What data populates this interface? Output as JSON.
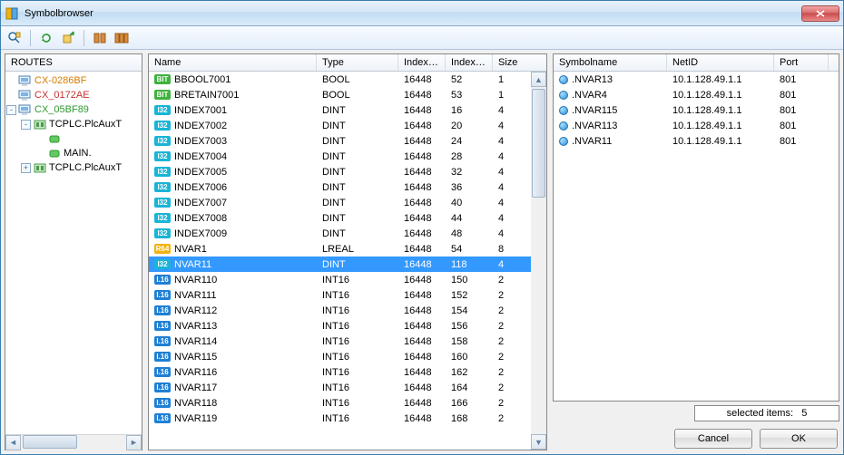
{
  "window": {
    "title": "Symbolbrowser"
  },
  "toolbar": {
    "items": [
      "find",
      "refresh",
      "export",
      "sep",
      "connect",
      "connect-multi"
    ]
  },
  "tree": {
    "header": "ROUTES",
    "nodes": [
      {
        "indent": 0,
        "icon": "pc",
        "label": "CX-0286BF",
        "class": "c-orange",
        "toggle": null
      },
      {
        "indent": 0,
        "icon": "pc",
        "label": "CX_0172AE",
        "class": "c-red",
        "toggle": null
      },
      {
        "indent": 0,
        "icon": "pc",
        "label": "CX_05BF89",
        "class": "c-green",
        "toggle": "-"
      },
      {
        "indent": 1,
        "icon": "db",
        "label": "TCPLC.PlcAuxT",
        "class": "",
        "toggle": "-"
      },
      {
        "indent": 2,
        "icon": "var",
        "label": "",
        "class": "",
        "toggle": null
      },
      {
        "indent": 2,
        "icon": "var",
        "label": "MAIN.",
        "class": "",
        "toggle": null
      },
      {
        "indent": 1,
        "icon": "db",
        "label": "TCPLC.PlcAuxT",
        "class": "",
        "toggle": "+"
      }
    ]
  },
  "grid": {
    "cols": [
      "Name",
      "Type",
      "Index-...",
      "Index-...",
      "Size"
    ],
    "rows": [
      {
        "chip": "bit",
        "chipTxt": "BIT",
        "name": "BBOOL7001",
        "type": "BOOL",
        "i1": "16448",
        "i2": "52",
        "sz": "1",
        "sel": false
      },
      {
        "chip": "bit",
        "chipTxt": "BIT",
        "name": "BRETAIN7001",
        "type": "BOOL",
        "i1": "16448",
        "i2": "53",
        "sz": "1",
        "sel": false
      },
      {
        "chip": "i32",
        "chipTxt": "I32",
        "name": "INDEX7001",
        "type": "DINT",
        "i1": "16448",
        "i2": "16",
        "sz": "4",
        "sel": false
      },
      {
        "chip": "i32",
        "chipTxt": "I32",
        "name": "INDEX7002",
        "type": "DINT",
        "i1": "16448",
        "i2": "20",
        "sz": "4",
        "sel": false
      },
      {
        "chip": "i32",
        "chipTxt": "I32",
        "name": "INDEX7003",
        "type": "DINT",
        "i1": "16448",
        "i2": "24",
        "sz": "4",
        "sel": false
      },
      {
        "chip": "i32",
        "chipTxt": "I32",
        "name": "INDEX7004",
        "type": "DINT",
        "i1": "16448",
        "i2": "28",
        "sz": "4",
        "sel": false
      },
      {
        "chip": "i32",
        "chipTxt": "I32",
        "name": "INDEX7005",
        "type": "DINT",
        "i1": "16448",
        "i2": "32",
        "sz": "4",
        "sel": false
      },
      {
        "chip": "i32",
        "chipTxt": "I32",
        "name": "INDEX7006",
        "type": "DINT",
        "i1": "16448",
        "i2": "36",
        "sz": "4",
        "sel": false
      },
      {
        "chip": "i32",
        "chipTxt": "I32",
        "name": "INDEX7007",
        "type": "DINT",
        "i1": "16448",
        "i2": "40",
        "sz": "4",
        "sel": false
      },
      {
        "chip": "i32",
        "chipTxt": "I32",
        "name": "INDEX7008",
        "type": "DINT",
        "i1": "16448",
        "i2": "44",
        "sz": "4",
        "sel": false
      },
      {
        "chip": "i32",
        "chipTxt": "I32",
        "name": "INDEX7009",
        "type": "DINT",
        "i1": "16448",
        "i2": "48",
        "sz": "4",
        "sel": false
      },
      {
        "chip": "r64",
        "chipTxt": "R64",
        "name": "NVAR1",
        "type": "LREAL",
        "i1": "16448",
        "i2": "54",
        "sz": "8",
        "sel": false
      },
      {
        "chip": "i32",
        "chipTxt": "I32",
        "name": "NVAR11",
        "type": "DINT",
        "i1": "16448",
        "i2": "118",
        "sz": "4",
        "sel": true
      },
      {
        "chip": "i16",
        "chipTxt": "I.16",
        "name": "NVAR110",
        "type": "INT16",
        "i1": "16448",
        "i2": "150",
        "sz": "2",
        "sel": false
      },
      {
        "chip": "i16",
        "chipTxt": "I.16",
        "name": "NVAR111",
        "type": "INT16",
        "i1": "16448",
        "i2": "152",
        "sz": "2",
        "sel": false
      },
      {
        "chip": "i16",
        "chipTxt": "I.16",
        "name": "NVAR112",
        "type": "INT16",
        "i1": "16448",
        "i2": "154",
        "sz": "2",
        "sel": false
      },
      {
        "chip": "i16",
        "chipTxt": "I.16",
        "name": "NVAR113",
        "type": "INT16",
        "i1": "16448",
        "i2": "156",
        "sz": "2",
        "sel": false
      },
      {
        "chip": "i16",
        "chipTxt": "I.16",
        "name": "NVAR114",
        "type": "INT16",
        "i1": "16448",
        "i2": "158",
        "sz": "2",
        "sel": false
      },
      {
        "chip": "i16",
        "chipTxt": "I.16",
        "name": "NVAR115",
        "type": "INT16",
        "i1": "16448",
        "i2": "160",
        "sz": "2",
        "sel": false
      },
      {
        "chip": "i16",
        "chipTxt": "I.16",
        "name": "NVAR116",
        "type": "INT16",
        "i1": "16448",
        "i2": "162",
        "sz": "2",
        "sel": false
      },
      {
        "chip": "i16",
        "chipTxt": "I.16",
        "name": "NVAR117",
        "type": "INT16",
        "i1": "16448",
        "i2": "164",
        "sz": "2",
        "sel": false
      },
      {
        "chip": "i16",
        "chipTxt": "I.16",
        "name": "NVAR118",
        "type": "INT16",
        "i1": "16448",
        "i2": "166",
        "sz": "2",
        "sel": false
      },
      {
        "chip": "i16",
        "chipTxt": "I.16",
        "name": "NVAR119",
        "type": "INT16",
        "i1": "16448",
        "i2": "168",
        "sz": "2",
        "sel": false
      }
    ]
  },
  "selected": {
    "cols": [
      "Symbolname",
      "NetID",
      "Port"
    ],
    "rows": [
      {
        "name": ".NVAR13",
        "net": "10.1.128.49.1.1",
        "port": "801"
      },
      {
        "name": ".NVAR4",
        "net": "10.1.128.49.1.1",
        "port": "801"
      },
      {
        "name": ".NVAR115",
        "net": "10.1.128.49.1.1",
        "port": "801"
      },
      {
        "name": ".NVAR113",
        "net": "10.1.128.49.1.1",
        "port": "801"
      },
      {
        "name": ".NVAR11",
        "net": "10.1.128.49.1.1",
        "port": "801"
      }
    ]
  },
  "status": {
    "label": "selected items:",
    "count": "5"
  },
  "buttons": {
    "cancel": "Cancel",
    "ok": "OK"
  }
}
